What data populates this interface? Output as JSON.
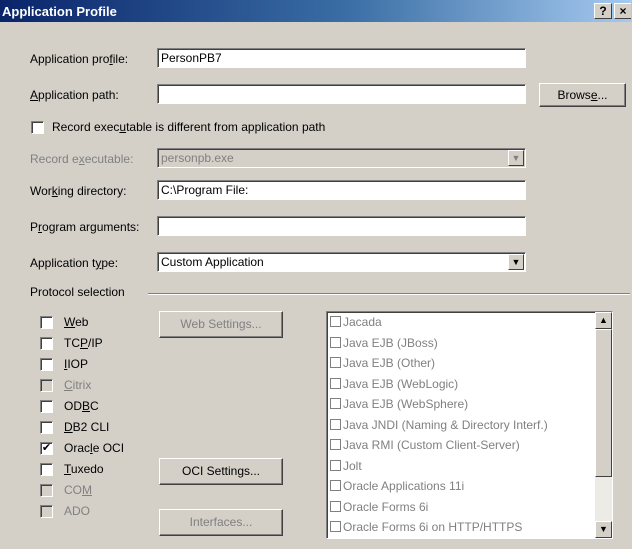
{
  "window": {
    "title": "Application Profile",
    "help": "?",
    "close": "×"
  },
  "labels": {
    "app_profile": [
      "Application pro",
      "f",
      "ile:"
    ],
    "app_path": [
      "",
      "A",
      "pplication path:"
    ],
    "record_diff": [
      "Record exec",
      "u",
      "table is different from application path"
    ],
    "record_exe": [
      "Record e",
      "x",
      "ecutable:"
    ],
    "working_dir": [
      "Wor",
      "k",
      "ing directory:"
    ],
    "program_args": [
      "P",
      "r",
      "ogram arguments:"
    ],
    "app_type": [
      "Application t",
      "y",
      "pe:"
    ],
    "protocol_selection": "Protocol selection"
  },
  "fields": {
    "app_profile": "PersonPB7",
    "app_path": "",
    "record_exe": "personpb.exe",
    "working_dir": "C:\\Program File:",
    "program_args": "",
    "app_type": "Custom Application"
  },
  "buttons": {
    "browse": [
      "Brows",
      "e",
      "..."
    ],
    "web_settings": "Web Settings...",
    "oci_settings": "OCI Settings...",
    "interfaces": "Interfaces..."
  },
  "protocols": [
    {
      "pre": "",
      "key": "W",
      "post": "eb",
      "checked": false,
      "enabled": true
    },
    {
      "pre": "TC",
      "key": "P",
      "post": "/IP",
      "checked": false,
      "enabled": true
    },
    {
      "pre": "",
      "key": "I",
      "post": "IOP",
      "checked": false,
      "enabled": true
    },
    {
      "pre": "",
      "key": "C",
      "post": "itrix",
      "checked": false,
      "enabled": false
    },
    {
      "pre": "OD",
      "key": "B",
      "post": "C",
      "checked": false,
      "enabled": true
    },
    {
      "pre": "",
      "key": "D",
      "post": "B2 CLI",
      "checked": false,
      "enabled": true
    },
    {
      "pre": "Orac",
      "key": "l",
      "post": "e OCI",
      "checked": true,
      "enabled": true
    },
    {
      "pre": "",
      "key": "T",
      "post": "uxedo",
      "checked": false,
      "enabled": true
    },
    {
      "pre": "CO",
      "key": "M",
      "post": "",
      "checked": false,
      "enabled": false
    },
    {
      "pre": "ADO",
      "key": "",
      "post": "",
      "checked": false,
      "enabled": false
    }
  ],
  "interface_list": [
    "Jacada",
    "Java EJB (JBoss)",
    "Java EJB (Other)",
    "Java EJB (WebLogic)",
    "Java EJB (WebSphere)",
    "Java JNDI (Naming & Directory Interf.)",
    "Java RMI (Custom Client-Server)",
    "Jolt",
    "Oracle Applications 11i",
    "Oracle Forms 6i",
    "Oracle Forms 6i on HTTP/HTTPS"
  ],
  "icons": {
    "up": "▲",
    "down": "▼",
    "check": "✔"
  }
}
